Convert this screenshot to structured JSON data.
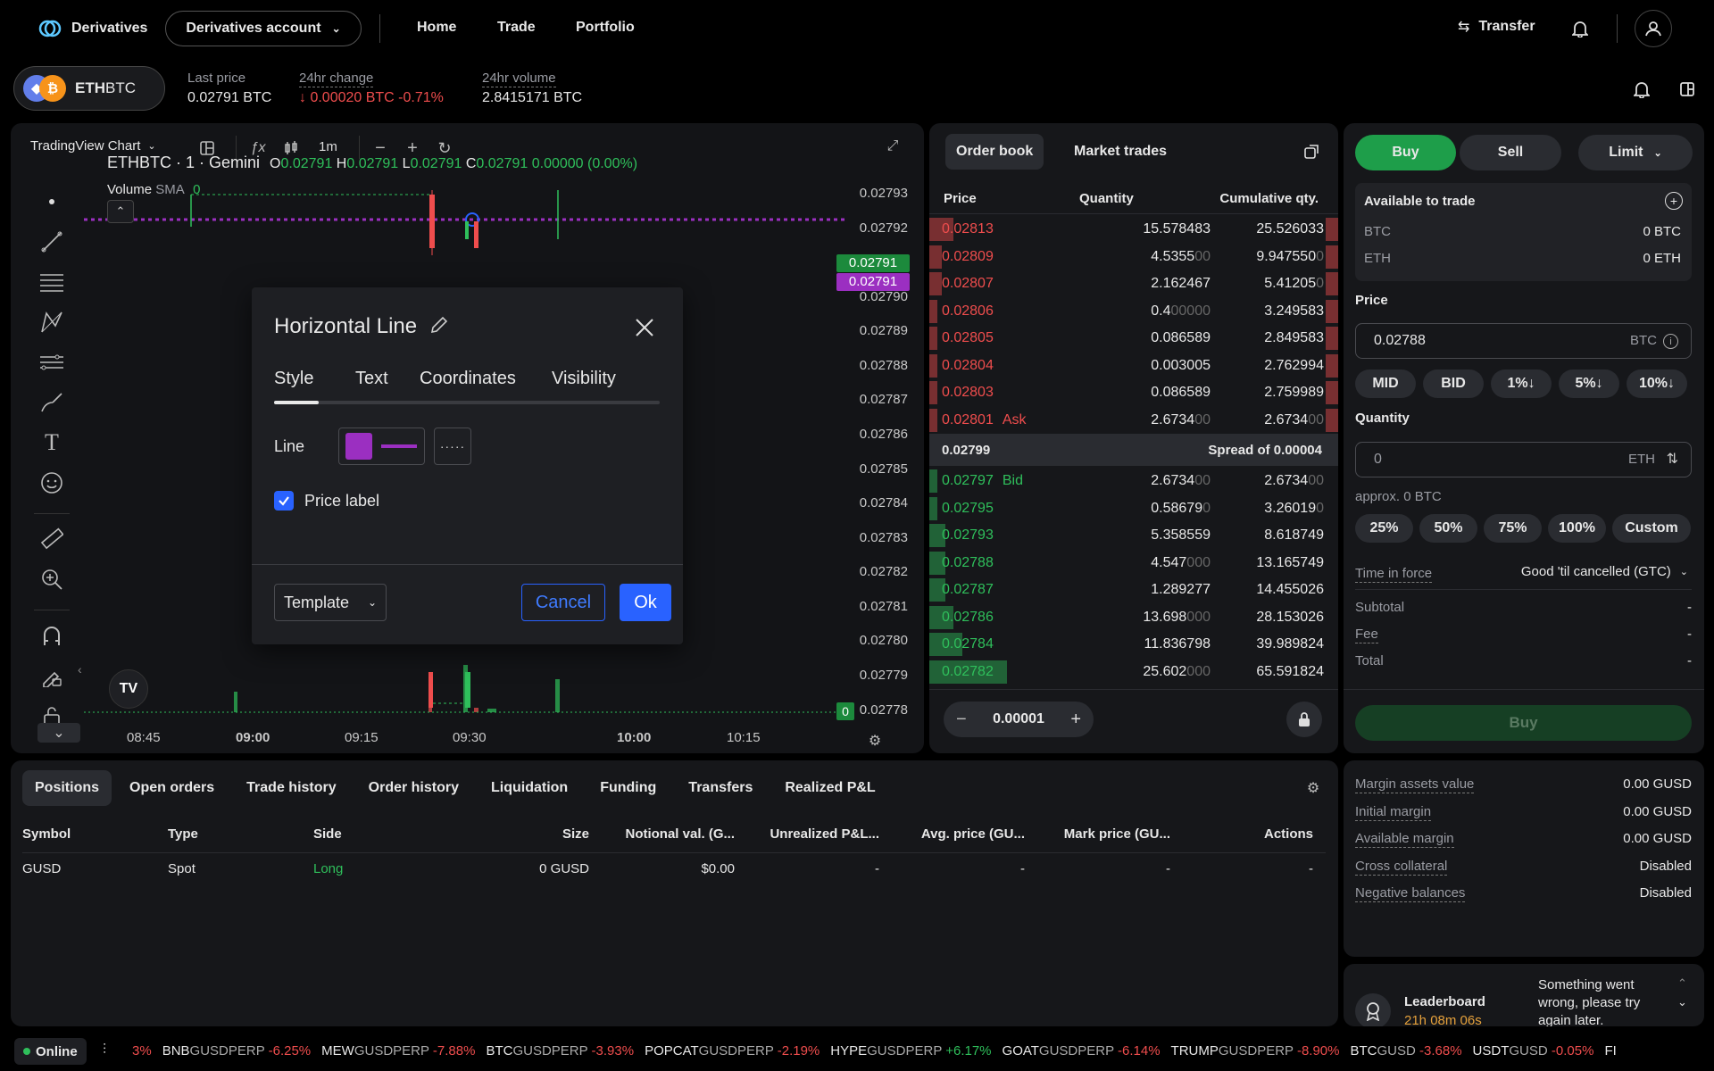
{
  "topnav": {
    "brand": "Derivatives",
    "account": "Derivatives account",
    "links": [
      "Home",
      "Trade",
      "Portfolio"
    ],
    "transfer": "Transfer",
    "icons": {
      "logo": "gemini-logo-icon",
      "bell": "bell-icon",
      "user": "user-icon",
      "transfer": "transfer-arrows-icon"
    }
  },
  "market": {
    "symbol": "ETHBTC",
    "symbol_bold": "ETH",
    "symbol_rest": "BTC",
    "last_price_label": "Last price",
    "last_price": "0.02791 BTC",
    "change_label": "24hr change",
    "change_value": "↓ 0.00020 BTC -0.71%",
    "volume_label": "24hr volume",
    "volume_value": "2.8415171 BTC"
  },
  "chart": {
    "source": "TradingView Chart",
    "interval": "1m",
    "legend_title": "ETHBTC · 1 · Gemini",
    "ohlc": {
      "o_label": "O",
      "o": "0.02791",
      "h_label": "H",
      "h": "0.02791",
      "l_label": "L",
      "l": "0.02791",
      "c_label": "C",
      "c": "0.02791",
      "change": "0.00000 (0.00%)"
    },
    "volume_label": "Volume",
    "volume_sma": "SMA",
    "volume_value": "0",
    "price_ticks": [
      "0.02793",
      "0.02792",
      "0.02790",
      "0.02789",
      "0.02788",
      "0.02787",
      "0.02786",
      "0.02785",
      "0.02784",
      "0.02783",
      "0.02782",
      "0.02781",
      "0.02780",
      "0.02779",
      "0.02778"
    ],
    "price_tag_green": "0.02791",
    "price_tag_purple": "0.02791",
    "price_tag_bottom": "0",
    "time_ticks": [
      "08:45",
      "09:00",
      "09:15",
      "09:30",
      "10:00",
      "10:15"
    ],
    "line_color": "#9b2fc1",
    "watermark": "TV"
  },
  "dialog": {
    "title": "Horizontal Line",
    "tabs": [
      "Style",
      "Text",
      "Coordinates",
      "Visibility"
    ],
    "line_label": "Line",
    "line_color": "#9b2fc1",
    "line_style": "·····",
    "price_label": "Price label",
    "template": "Template",
    "cancel": "Cancel",
    "ok": "Ok"
  },
  "orderbook": {
    "tabs": [
      "Order book",
      "Market trades"
    ],
    "headers": [
      "Price",
      "Quantity",
      "Cumulative qty."
    ],
    "asks": [
      {
        "price": "0.02813",
        "qty": "15.578483",
        "qty_dim": "",
        "cum": "25.526033",
        "cum_dim": "",
        "depth": 0.06
      },
      {
        "price": "0.02809",
        "qty": "4.5355",
        "qty_dim": "00",
        "cum": "9.947550",
        "cum_dim": "0",
        "depth": 0.03
      },
      {
        "price": "0.02807",
        "qty": "2.162467",
        "qty_dim": "",
        "cum": "5.41205",
        "cum_dim": "0",
        "depth": 0.03
      },
      {
        "price": "0.02806",
        "qty": "0.4",
        "qty_dim": "00000",
        "cum": "3.249583",
        "cum_dim": "",
        "depth": 0.02
      },
      {
        "price": "0.02805",
        "qty": "0.086589",
        "qty_dim": "",
        "cum": "2.849583",
        "cum_dim": "",
        "depth": 0.02
      },
      {
        "price": "0.02804",
        "qty": "0.003005",
        "qty_dim": "",
        "cum": "2.762994",
        "cum_dim": "",
        "depth": 0.02
      },
      {
        "price": "0.02803",
        "qty": "0.086589",
        "qty_dim": "",
        "cum": "2.759989",
        "cum_dim": "",
        "depth": 0.02
      },
      {
        "price": "0.02801",
        "qty": "2.6734",
        "qty_dim": "00",
        "cum": "2.6734",
        "cum_dim": "00",
        "depth": 0.02,
        "tag": "Ask"
      }
    ],
    "spread_price": "0.02799",
    "spread_text": "Spread of 0.00004",
    "bids": [
      {
        "price": "0.02797",
        "qty": "2.6734",
        "qty_dim": "00",
        "cum": "2.6734",
        "cum_dim": "00",
        "depth": 0.02,
        "tag": "Bid"
      },
      {
        "price": "0.02795",
        "qty": "0.58679",
        "qty_dim": "0",
        "cum": "3.26019",
        "cum_dim": "0",
        "depth": 0.02
      },
      {
        "price": "0.02793",
        "qty": "5.358559",
        "qty_dim": "",
        "cum": "8.618749",
        "cum_dim": "",
        "depth": 0.04
      },
      {
        "price": "0.02788",
        "qty": "4.547",
        "qty_dim": "000",
        "cum": "13.165749",
        "cum_dim": "",
        "depth": 0.04
      },
      {
        "price": "0.02787",
        "qty": "1.289277",
        "qty_dim": "",
        "cum": "14.455026",
        "cum_dim": "",
        "depth": 0.04
      },
      {
        "price": "0.02786",
        "qty": "13.698",
        "qty_dim": "000",
        "cum": "28.153026",
        "cum_dim": "",
        "depth": 0.06
      },
      {
        "price": "0.02784",
        "qty": "11.836798",
        "qty_dim": "",
        "cum": "39.989824",
        "cum_dim": "",
        "depth": 0.08
      },
      {
        "price": "0.02782",
        "qty": "25.602",
        "qty_dim": "000",
        "cum": "65.591824",
        "cum_dim": "",
        "depth": 0.19
      }
    ],
    "tick_size": "0.00001"
  },
  "order": {
    "buy": "Buy",
    "sell": "Sell",
    "type": "Limit",
    "available_title": "Available to trade",
    "btc_label": "BTC",
    "btc_value": "0 BTC",
    "eth_label": "ETH",
    "eth_value": "0 ETH",
    "price_label": "Price",
    "price_value": "0.02788",
    "price_unit": "BTC",
    "price_buttons": [
      "MID",
      "BID",
      "1%↓",
      "5%↓",
      "10%↓"
    ],
    "quantity_label": "Quantity",
    "quantity_placeholder": "0",
    "quantity_unit": "ETH",
    "approx": "approx. 0 BTC",
    "qty_buttons": [
      "25%",
      "50%",
      "75%",
      "100%",
      "Custom"
    ],
    "tif_label": "Time in force",
    "tif_value": "Good 'til cancelled (GTC)",
    "subtotal_label": "Subtotal",
    "subtotal": "-",
    "fee_label": "Fee",
    "fee": "-",
    "total_label": "Total",
    "total": "-",
    "submit": "Buy"
  },
  "bottom": {
    "tabs": [
      "Positions",
      "Open orders",
      "Trade history",
      "Order history",
      "Liquidation",
      "Funding",
      "Transfers",
      "Realized P&L"
    ],
    "headers": [
      "Symbol",
      "Type",
      "Side",
      "Size",
      "Notional val. (G...",
      "Unrealized P&L...",
      "Avg. price (GU...",
      "Mark price (GU...",
      "Actions"
    ],
    "rows": [
      [
        "GUSD",
        "Spot",
        "Long",
        "0 GUSD",
        "$0.00",
        "-",
        "-",
        "-",
        "-"
      ]
    ]
  },
  "margin": {
    "rows": [
      {
        "label": "Margin assets value",
        "value": "0.00 GUSD"
      },
      {
        "label": "Initial margin",
        "value": "0.00 GUSD"
      },
      {
        "label": "Available margin",
        "value": "0.00 GUSD"
      },
      {
        "label": "Cross collateral",
        "value": "Disabled"
      },
      {
        "label": "Negative balances",
        "value": "Disabled"
      }
    ]
  },
  "leaderboard": {
    "title": "Leaderboard",
    "timer": "21h 08m 06s",
    "error": "Something went wrong, please try again later."
  },
  "status": {
    "online": "Online",
    "tickers": [
      {
        "sym": "",
        "suffix": "",
        "chg": "3%",
        "up": false
      },
      {
        "sym": "BNB",
        "suffix": "GUSDPERP",
        "chg": "-6.25%",
        "up": false
      },
      {
        "sym": "MEW",
        "suffix": "GUSDPERP",
        "chg": "-7.88%",
        "up": false
      },
      {
        "sym": "BTC",
        "suffix": "GUSDPERP",
        "chg": "-3.93%",
        "up": false
      },
      {
        "sym": "POPCAT",
        "suffix": "GUSDPERP",
        "chg": "-2.19%",
        "up": false
      },
      {
        "sym": "HYPE",
        "suffix": "GUSDPERP",
        "chg": "+6.17%",
        "up": true
      },
      {
        "sym": "GOAT",
        "suffix": "GUSDPERP",
        "chg": "-6.14%",
        "up": false
      },
      {
        "sym": "TRUMP",
        "suffix": "GUSDPERP",
        "chg": "-8.90%",
        "up": false
      },
      {
        "sym": "BTC",
        "suffix": "GUSD",
        "chg": "-3.68%",
        "up": false
      },
      {
        "sym": "USDT",
        "suffix": "GUSD",
        "chg": "-0.05%",
        "up": false
      },
      {
        "sym": "FI",
        "suffix": "",
        "chg": "",
        "up": false
      }
    ]
  },
  "colors": {
    "green": "#2fbf5b",
    "red": "#ef4d4d",
    "purple": "#9b2fc1",
    "accent_blue": "#2962ff"
  }
}
